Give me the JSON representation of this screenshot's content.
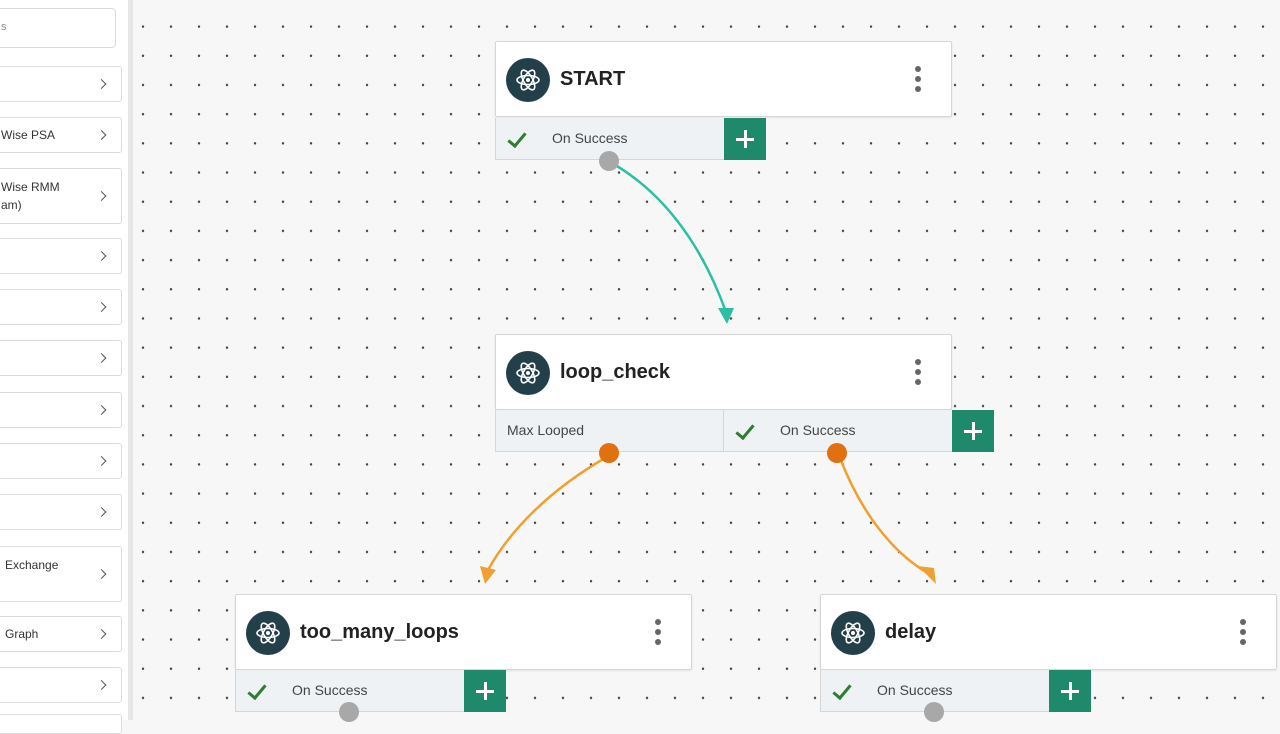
{
  "sidebar": {
    "search": {
      "value": "s"
    },
    "items": [
      {
        "label": ""
      },
      {
        "label": "Wise PSA"
      },
      {
        "label": "Wise RMM\nam)"
      },
      {
        "label": ""
      },
      {
        "label": ""
      },
      {
        "label": ""
      },
      {
        "label": ""
      },
      {
        "label": ""
      },
      {
        "label": ""
      },
      {
        "label": "Exchange"
      },
      {
        "label": "Graph"
      },
      {
        "label": ""
      }
    ]
  },
  "nodes": {
    "start": {
      "title": "START",
      "outlets": [
        "On Success"
      ]
    },
    "loop_check": {
      "title": "loop_check",
      "outlets": [
        "Max Looped",
        "On Success"
      ]
    },
    "too_many_loops": {
      "title": "too_many_loops",
      "outlets": [
        "On Success"
      ]
    },
    "delay": {
      "title": "delay",
      "outlets": [
        "On Success"
      ]
    }
  },
  "icons": {
    "node": "atom-icon",
    "menu": "kebab-menu-icon",
    "add": "plus-icon",
    "success": "checkmark-icon",
    "sidebar_item": "chevron-right-icon"
  },
  "colors": {
    "node_icon_bg": "#23404a",
    "add_button": "#1e8a6b",
    "link_success": "#2bbfa4",
    "link_branch": "#f0a030",
    "port_active": "#e07010",
    "port_idle": "#a8a8a8",
    "check": "#2e7d32"
  }
}
